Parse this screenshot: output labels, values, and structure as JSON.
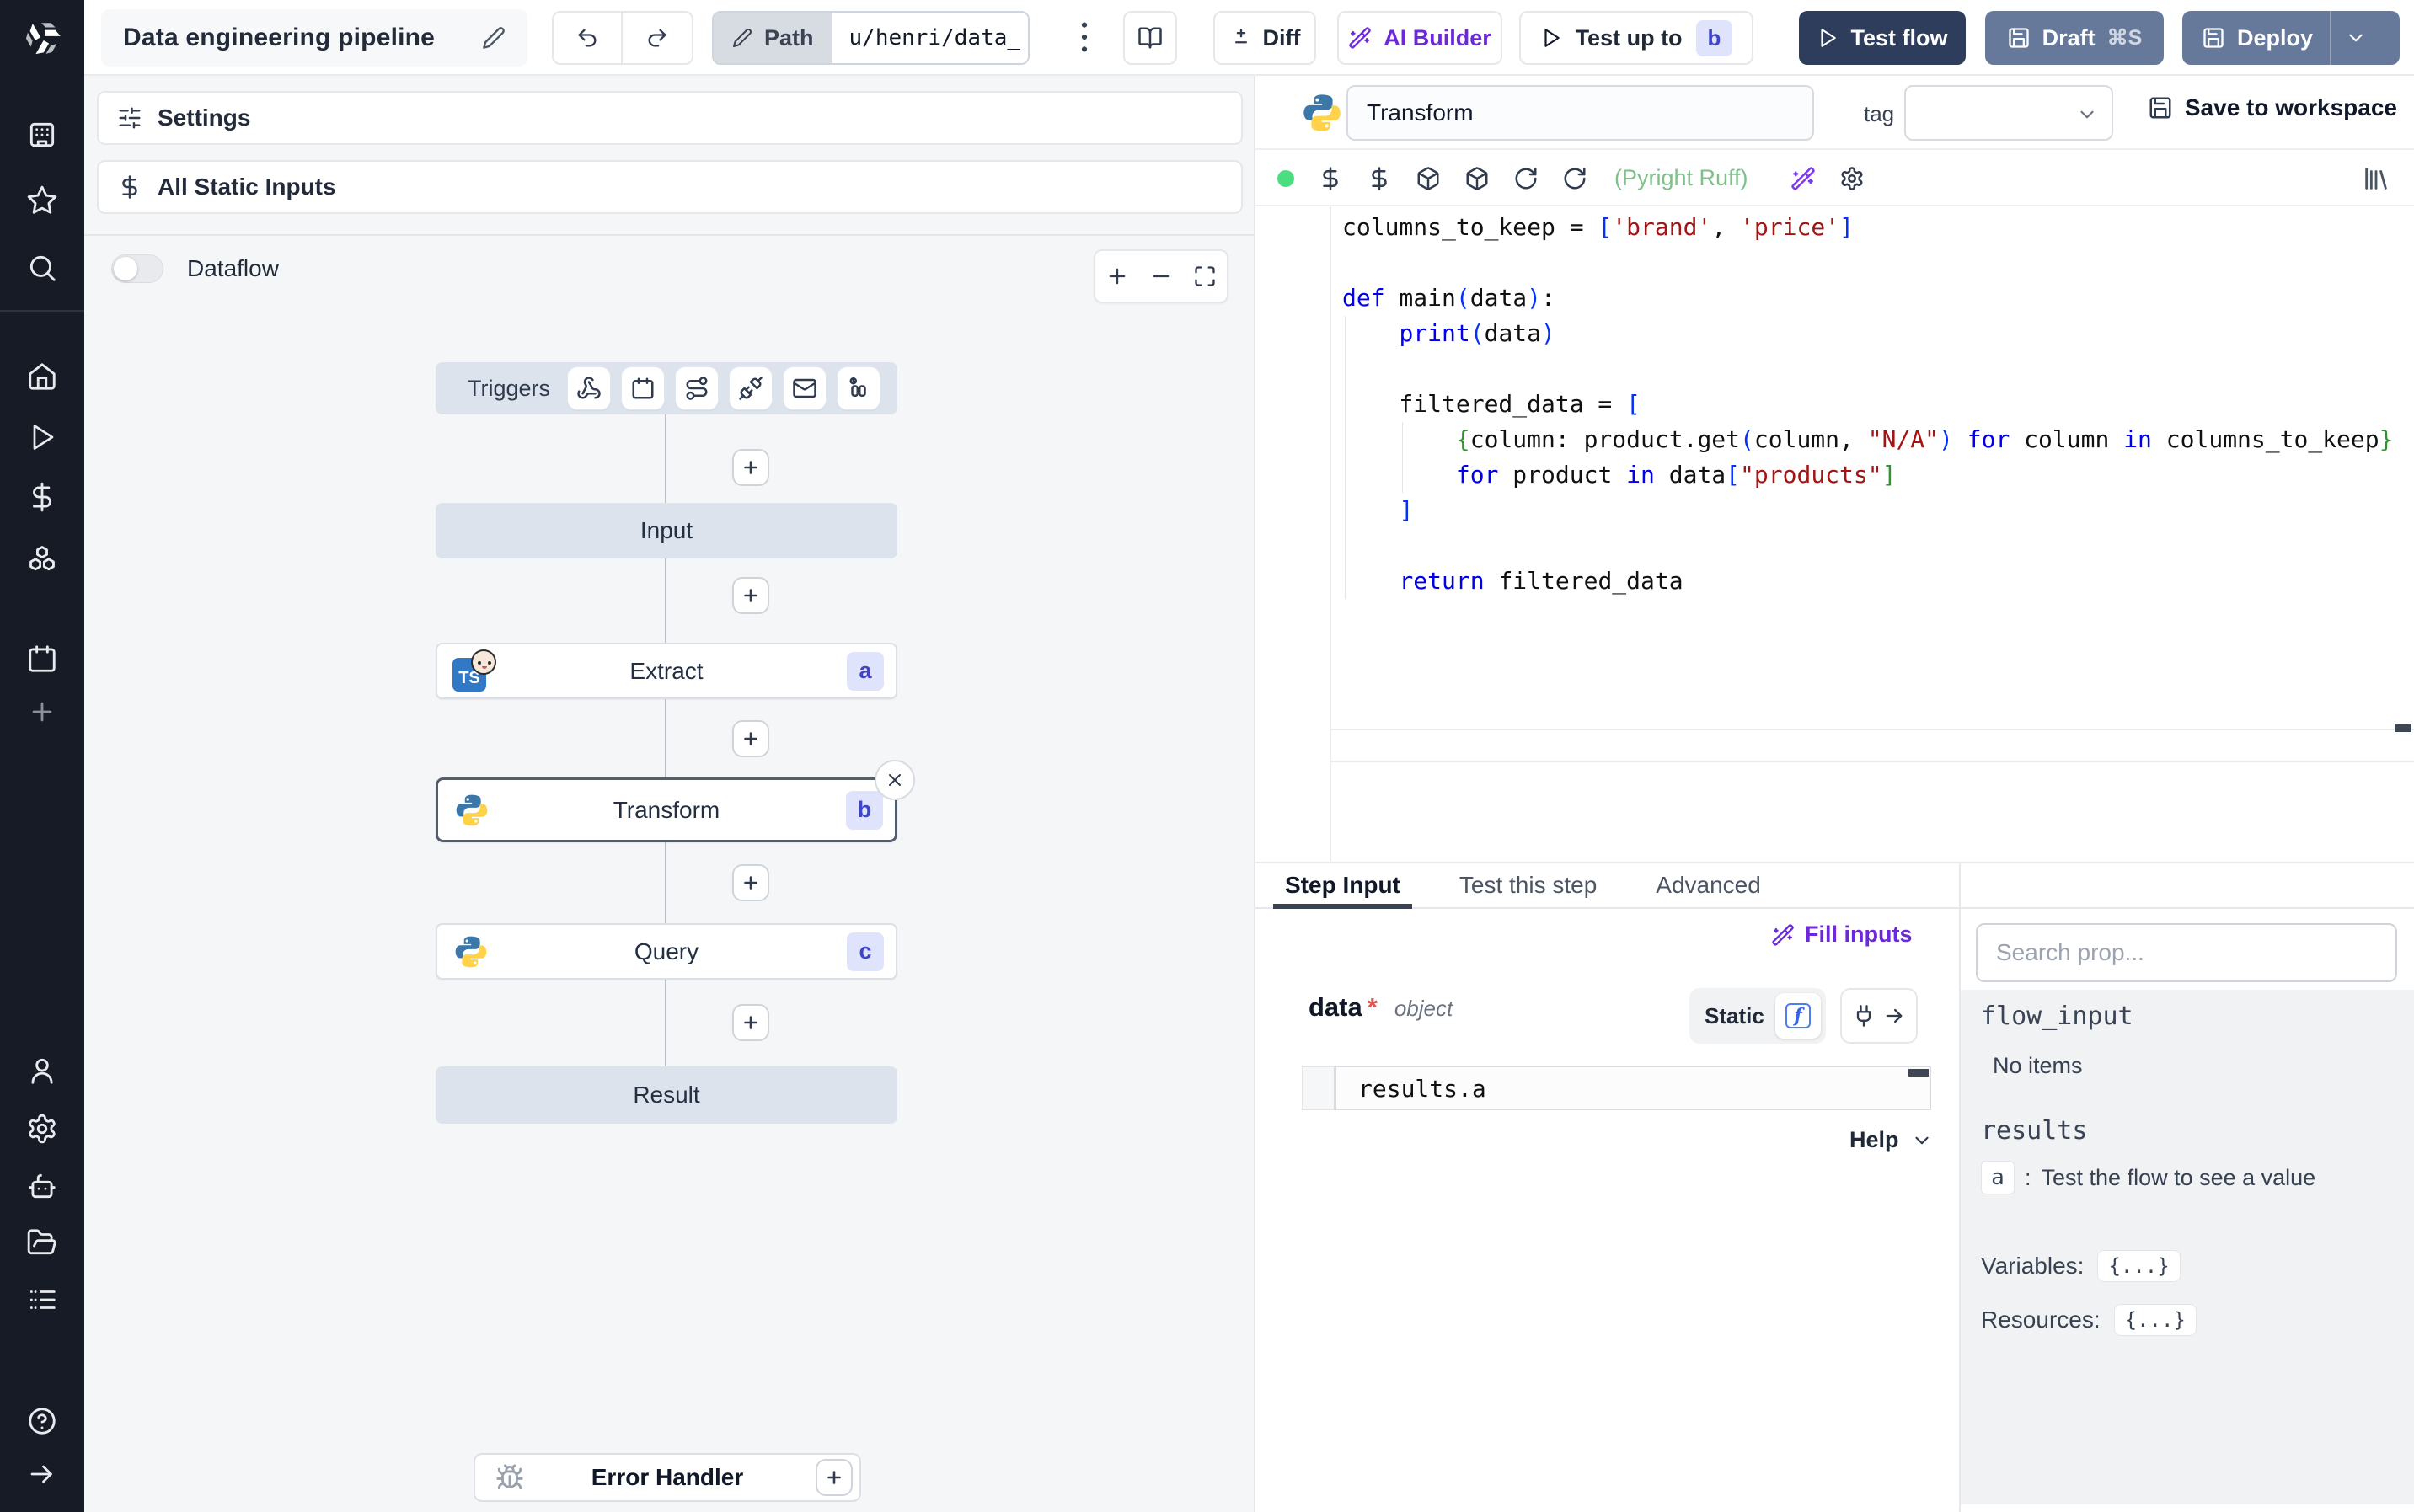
{
  "topbar": {
    "title": "Data engineering pipeline",
    "path_label": "Path",
    "path_value": "u/henri/data_",
    "diff_label": "Diff",
    "ai_builder_label": "AI Builder",
    "test_up_to_label": "Test up to",
    "test_up_to_badge": "b",
    "test_flow_label": "Test flow",
    "draft_label": "Draft",
    "draft_shortcut": "⌘S",
    "deploy_label": "Deploy"
  },
  "sidebar": {
    "icons": [
      "building",
      "star",
      "search",
      "home",
      "play",
      "dollar",
      "boxes",
      "calendar",
      "plus",
      "user",
      "settings-gear",
      "bot",
      "folder",
      "list",
      "help-circle",
      "arrow-right"
    ]
  },
  "flow": {
    "settings_label": "Settings",
    "static_inputs_label": "All Static Inputs",
    "dataflow_label": "Dataflow",
    "triggers_label": "Triggers",
    "trigger_icons": [
      "webhook",
      "calendar",
      "route",
      "plug",
      "mail",
      "poll"
    ],
    "nodes": {
      "input": {
        "label": "Input"
      },
      "extract": {
        "label": "Extract",
        "badge": "a"
      },
      "transform": {
        "label": "Transform",
        "badge": "b"
      },
      "query": {
        "label": "Query",
        "badge": "c"
      },
      "result": {
        "label": "Result"
      }
    },
    "error_handler_label": "Error Handler"
  },
  "editor": {
    "step_name": "Transform",
    "tag_label": "tag",
    "save_label": "Save to workspace",
    "lint_status": "(Pyright Ruff)",
    "language": "python",
    "code_lines": [
      [
        [
          "t",
          "columns_to_keep = "
        ],
        [
          "b1",
          "["
        ],
        [
          "s",
          "'brand'"
        ],
        [
          "t",
          ", "
        ],
        [
          "s",
          "'price'"
        ],
        [
          "b1",
          "]"
        ]
      ],
      [],
      [
        [
          "k",
          "def"
        ],
        [
          "t",
          " main"
        ],
        [
          "b1",
          "("
        ],
        [
          "t",
          "data"
        ],
        [
          "b1",
          ")"
        ],
        [
          "t",
          ":"
        ]
      ],
      [
        [
          "t",
          "    "
        ],
        [
          "k",
          "print"
        ],
        [
          "b1",
          "("
        ],
        [
          "t",
          "data"
        ],
        [
          "b1",
          ")"
        ]
      ],
      [],
      [
        [
          "t",
          "    filtered_data = "
        ],
        [
          "b1",
          "["
        ]
      ],
      [
        [
          "t",
          "        "
        ],
        [
          "b2",
          "{"
        ],
        [
          "t",
          "column: product.get"
        ],
        [
          "b1",
          "("
        ],
        [
          "t",
          "column, "
        ],
        [
          "s",
          "\"N/A\""
        ],
        [
          "b1",
          ")"
        ],
        [
          "t",
          " "
        ],
        [
          "k",
          "for"
        ],
        [
          "t",
          " column "
        ],
        [
          "k",
          "in"
        ],
        [
          "t",
          " columns_to_keep"
        ],
        [
          "b2",
          "}"
        ]
      ],
      [
        [
          "t",
          "        "
        ],
        [
          "k",
          "for"
        ],
        [
          "t",
          " product "
        ],
        [
          "k",
          "in"
        ],
        [
          "t",
          " data"
        ],
        [
          "b1",
          "["
        ],
        [
          "s",
          "\"products\""
        ],
        [
          "b2",
          "]"
        ]
      ],
      [
        [
          "t",
          "    "
        ],
        [
          "b1",
          "]"
        ]
      ],
      [],
      [
        [
          "t",
          "    "
        ],
        [
          "k",
          "return"
        ],
        [
          "t",
          " filtered_data"
        ]
      ]
    ]
  },
  "tabs": {
    "items": [
      "Step Input",
      "Test this step",
      "Advanced"
    ],
    "active": "Step Input"
  },
  "step_input": {
    "fill_inputs_label": "Fill inputs",
    "field_name": "data",
    "required_mark": "*",
    "field_type": "object",
    "static_label": "Static",
    "expression": "results.a",
    "help_label": "Help"
  },
  "props": {
    "search_placeholder": "Search prop...",
    "flow_input_label": "flow_input",
    "no_items_label": "No items",
    "results_label": "results",
    "result_key": "a",
    "result_hint": "Test the flow to see a value",
    "variables_label": "Variables:",
    "variables_value": "{...}",
    "resources_label": "Resources:",
    "resources_value": "{...}"
  },
  "colors": {
    "accent_purple": "#6d28d9",
    "primary_navy": "#2f3d5c",
    "secondary_slate": "#67799b",
    "badge_bg": "#dfe3fc",
    "badge_text": "#4044c9",
    "lint_green": "#7fbf8a",
    "status_green": "#4ade80",
    "sidebar_dark": "#171b26"
  }
}
